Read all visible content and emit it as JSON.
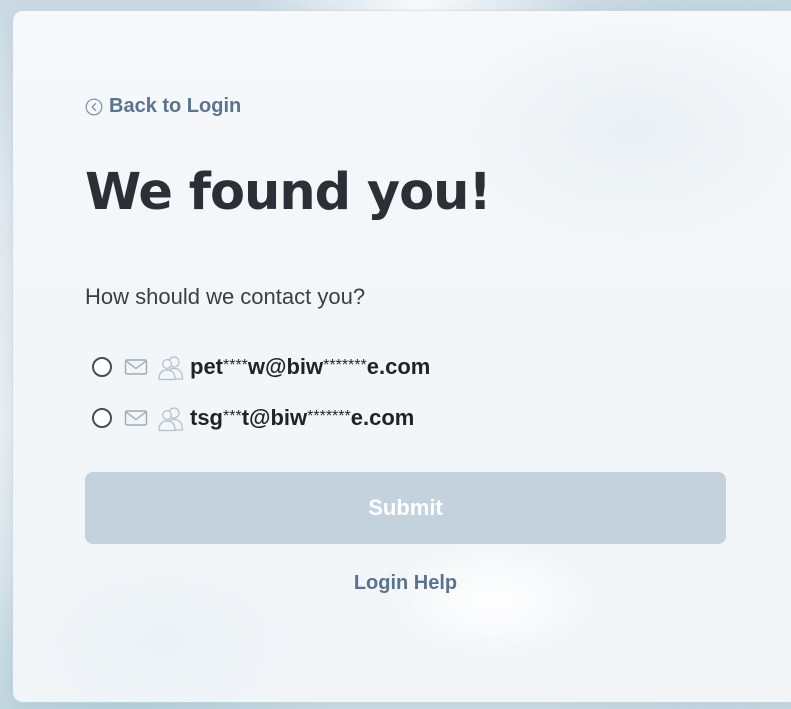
{
  "back_link": {
    "label": "Back to Login",
    "icon": "chevron-left-circle-icon"
  },
  "title": "We found you!",
  "prompt": "How should we contact you?",
  "contact_options": [
    {
      "icons": [
        "mail-icon",
        "people-icon"
      ],
      "email_prefix": "pet",
      "email_mask1": "****",
      "email_middle": "w@biw",
      "email_mask2": "*******",
      "email_suffix": "e.com",
      "selected": false
    },
    {
      "icons": [
        "mail-icon",
        "people-icon"
      ],
      "email_prefix": "tsg",
      "email_mask1": "***",
      "email_middle": "t@biw",
      "email_mask2": "*******",
      "email_suffix": "e.com",
      "selected": false
    }
  ],
  "submit_label": "Submit",
  "login_help_label": "Login Help",
  "colors": {
    "link": "#5c7390",
    "submit_disabled_bg": "#c3d2dc",
    "title": "#2b2f36"
  }
}
